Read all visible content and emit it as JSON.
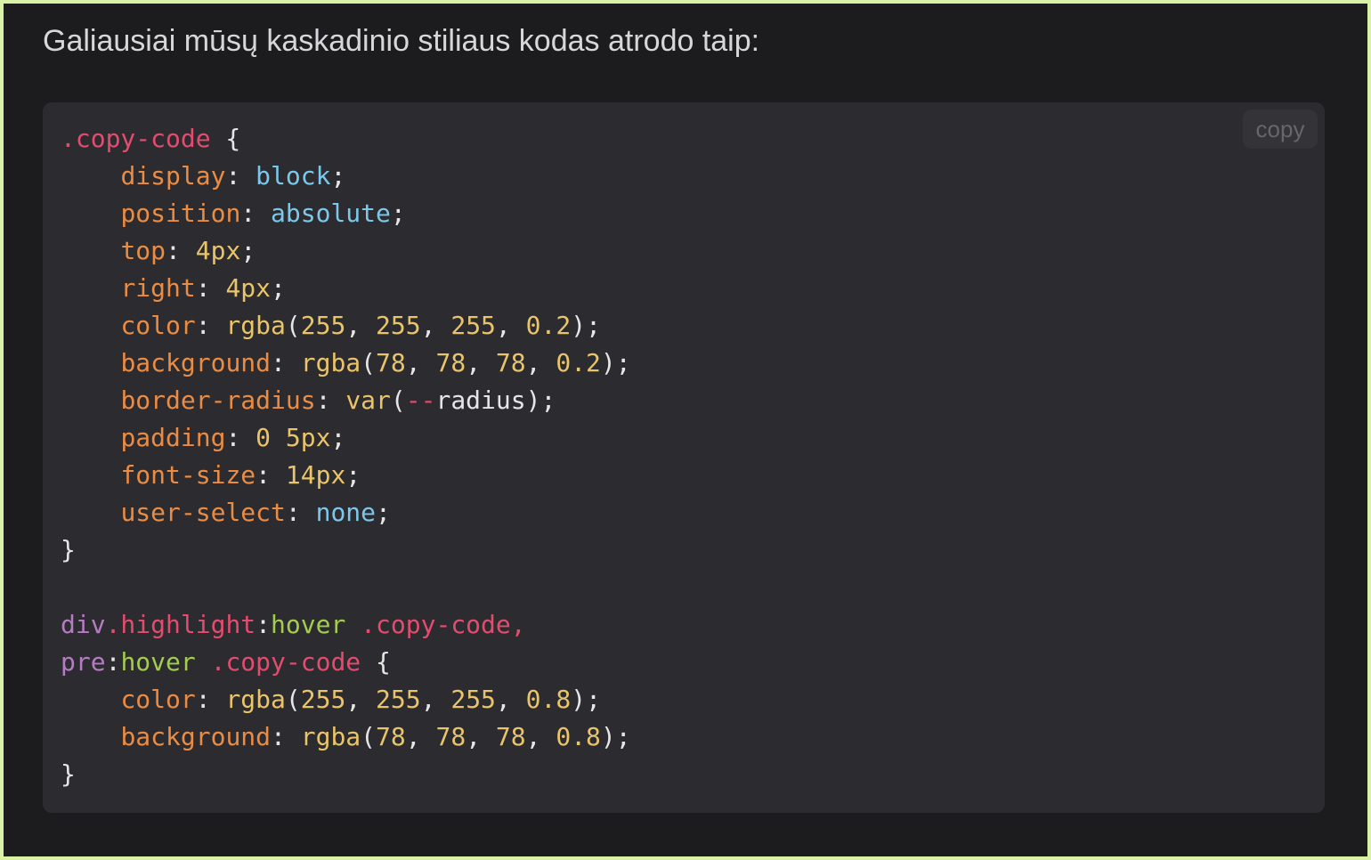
{
  "intro_text": "Galiausiai mūsų kaskadinio stiliaus kodas atrodo taip:",
  "copy_label": "copy",
  "code_lines": [
    [
      {
        "t": ".copy-code",
        "c": "class"
      },
      {
        "t": " {",
        "c": "punc"
      }
    ],
    [
      {
        "t": "    ",
        "c": "text"
      },
      {
        "t": "display",
        "c": "prop"
      },
      {
        "t": ": ",
        "c": "punc"
      },
      {
        "t": "block",
        "c": "kw"
      },
      {
        "t": ";",
        "c": "punc"
      }
    ],
    [
      {
        "t": "    ",
        "c": "text"
      },
      {
        "t": "position",
        "c": "prop"
      },
      {
        "t": ": ",
        "c": "punc"
      },
      {
        "t": "absolute",
        "c": "kw"
      },
      {
        "t": ";",
        "c": "punc"
      }
    ],
    [
      {
        "t": "    ",
        "c": "text"
      },
      {
        "t": "top",
        "c": "prop"
      },
      {
        "t": ": ",
        "c": "punc"
      },
      {
        "t": "4px",
        "c": "num"
      },
      {
        "t": ";",
        "c": "punc"
      }
    ],
    [
      {
        "t": "    ",
        "c": "text"
      },
      {
        "t": "right",
        "c": "prop"
      },
      {
        "t": ": ",
        "c": "punc"
      },
      {
        "t": "4px",
        "c": "num"
      },
      {
        "t": ";",
        "c": "punc"
      }
    ],
    [
      {
        "t": "    ",
        "c": "text"
      },
      {
        "t": "color",
        "c": "prop"
      },
      {
        "t": ": ",
        "c": "punc"
      },
      {
        "t": "rgba",
        "c": "num"
      },
      {
        "t": "(",
        "c": "punc"
      },
      {
        "t": "255",
        "c": "num"
      },
      {
        "t": ", ",
        "c": "punc"
      },
      {
        "t": "255",
        "c": "num"
      },
      {
        "t": ", ",
        "c": "punc"
      },
      {
        "t": "255",
        "c": "num"
      },
      {
        "t": ", ",
        "c": "punc"
      },
      {
        "t": "0.2",
        "c": "num"
      },
      {
        "t": ");",
        "c": "punc"
      }
    ],
    [
      {
        "t": "    ",
        "c": "text"
      },
      {
        "t": "background",
        "c": "prop"
      },
      {
        "t": ": ",
        "c": "punc"
      },
      {
        "t": "rgba",
        "c": "num"
      },
      {
        "t": "(",
        "c": "punc"
      },
      {
        "t": "78",
        "c": "num"
      },
      {
        "t": ", ",
        "c": "punc"
      },
      {
        "t": "78",
        "c": "num"
      },
      {
        "t": ", ",
        "c": "punc"
      },
      {
        "t": "78",
        "c": "num"
      },
      {
        "t": ", ",
        "c": "punc"
      },
      {
        "t": "0.2",
        "c": "num"
      },
      {
        "t": ");",
        "c": "punc"
      }
    ],
    [
      {
        "t": "    ",
        "c": "text"
      },
      {
        "t": "border-radius",
        "c": "prop"
      },
      {
        "t": ": ",
        "c": "punc"
      },
      {
        "t": "var",
        "c": "num"
      },
      {
        "t": "(",
        "c": "punc"
      },
      {
        "t": "--",
        "c": "class"
      },
      {
        "t": "radius",
        "c": "text"
      },
      {
        "t": ");",
        "c": "punc"
      }
    ],
    [
      {
        "t": "    ",
        "c": "text"
      },
      {
        "t": "padding",
        "c": "prop"
      },
      {
        "t": ": ",
        "c": "punc"
      },
      {
        "t": "0 5px",
        "c": "num"
      },
      {
        "t": ";",
        "c": "punc"
      }
    ],
    [
      {
        "t": "    ",
        "c": "text"
      },
      {
        "t": "font-size",
        "c": "prop"
      },
      {
        "t": ": ",
        "c": "punc"
      },
      {
        "t": "14px",
        "c": "num"
      },
      {
        "t": ";",
        "c": "punc"
      }
    ],
    [
      {
        "t": "    ",
        "c": "text"
      },
      {
        "t": "user-select",
        "c": "prop"
      },
      {
        "t": ": ",
        "c": "punc"
      },
      {
        "t": "none",
        "c": "kw"
      },
      {
        "t": ";",
        "c": "punc"
      }
    ],
    [
      {
        "t": "}",
        "c": "punc"
      }
    ],
    [],
    [
      {
        "t": "div",
        "c": "tag"
      },
      {
        "t": ".highlight",
        "c": "class"
      },
      {
        "t": ":",
        "c": "punc"
      },
      {
        "t": "hover",
        "c": "pseudo"
      },
      {
        "t": " ",
        "c": "text"
      },
      {
        "t": ".copy-code,",
        "c": "class"
      }
    ],
    [
      {
        "t": "pre",
        "c": "tag"
      },
      {
        "t": ":",
        "c": "punc"
      },
      {
        "t": "hover",
        "c": "pseudo"
      },
      {
        "t": " ",
        "c": "text"
      },
      {
        "t": ".copy-code",
        "c": "class"
      },
      {
        "t": " {",
        "c": "punc"
      }
    ],
    [
      {
        "t": "    ",
        "c": "text"
      },
      {
        "t": "color",
        "c": "prop"
      },
      {
        "t": ": ",
        "c": "punc"
      },
      {
        "t": "rgba",
        "c": "num"
      },
      {
        "t": "(",
        "c": "punc"
      },
      {
        "t": "255",
        "c": "num"
      },
      {
        "t": ", ",
        "c": "punc"
      },
      {
        "t": "255",
        "c": "num"
      },
      {
        "t": ", ",
        "c": "punc"
      },
      {
        "t": "255",
        "c": "num"
      },
      {
        "t": ", ",
        "c": "punc"
      },
      {
        "t": "0.8",
        "c": "num"
      },
      {
        "t": ");",
        "c": "punc"
      }
    ],
    [
      {
        "t": "    ",
        "c": "text"
      },
      {
        "t": "background",
        "c": "prop"
      },
      {
        "t": ": ",
        "c": "punc"
      },
      {
        "t": "rgba",
        "c": "num"
      },
      {
        "t": "(",
        "c": "punc"
      },
      {
        "t": "78",
        "c": "num"
      },
      {
        "t": ", ",
        "c": "punc"
      },
      {
        "t": "78",
        "c": "num"
      },
      {
        "t": ", ",
        "c": "punc"
      },
      {
        "t": "78",
        "c": "num"
      },
      {
        "t": ", ",
        "c": "punc"
      },
      {
        "t": "0.8",
        "c": "num"
      },
      {
        "t": ");",
        "c": "punc"
      }
    ],
    [
      {
        "t": "}",
        "c": "punc"
      }
    ]
  ],
  "colors": {
    "page_background": "#1c1c1e",
    "frame_border": "#d9f2a6",
    "code_background": "#2c2c30",
    "selector_class": "#e34c6f",
    "property": "#ea8c44",
    "keyword_value": "#7cc8ea",
    "number_function": "#e9c46a",
    "punctuation": "#e6e6e6",
    "tag": "#b77bc4",
    "pseudo_class": "#a4cc4f"
  }
}
